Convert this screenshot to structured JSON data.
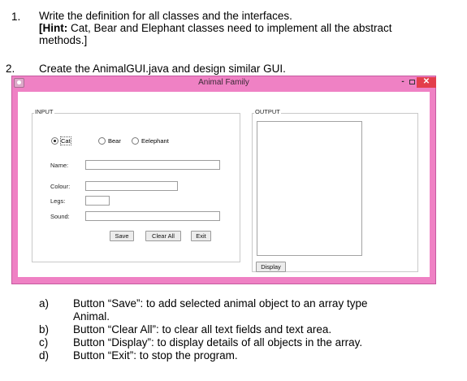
{
  "instructions": {
    "item1_num": "1.",
    "item1_line1": "Write the definition for all classes and the interfaces.",
    "item1_hint_label": "[Hint:",
    "item1_line2_rest": " Cat, Bear and Elephant classes need to implement all the abstract",
    "item1_line3": "methods.]",
    "item2_num": "2.",
    "item2_line1": "Create the AnimalGUI.java and design similar GUI."
  },
  "window": {
    "title": "Animal Family",
    "min_symbol": "-",
    "close_symbol": "✕"
  },
  "input_panel": {
    "label": "INPUT",
    "radios": [
      {
        "label": "Cat",
        "checked": true
      },
      {
        "label": "Bear",
        "checked": false
      },
      {
        "label": "Eelephant",
        "checked": false
      }
    ],
    "fields": [
      {
        "label": "Name:",
        "value": ""
      },
      {
        "label": "Colour:",
        "value": ""
      },
      {
        "label": "Legs:",
        "value": ""
      },
      {
        "label": "Sound:",
        "value": ""
      }
    ],
    "buttons": {
      "save": "Save",
      "clear_all": "Clear All",
      "exit": "Exit"
    }
  },
  "output_panel": {
    "label": "OUTPUT",
    "text": "",
    "display_button": "Display"
  },
  "notes": [
    {
      "letter": "a)",
      "line1": "Button “Save”: to add selected animal object to an array type",
      "line2": "Animal."
    },
    {
      "letter": "b)",
      "line1": "Button “Clear All”: to clear all text fields and text area."
    },
    {
      "letter": "c)",
      "line1": "Button “Display”: to display details of all objects in the array."
    },
    {
      "letter": "d)",
      "line1": "Button “Exit”: to stop the program."
    }
  ],
  "colors": {
    "window_frame": "#ef81c4",
    "close_button": "#e33e4b"
  }
}
